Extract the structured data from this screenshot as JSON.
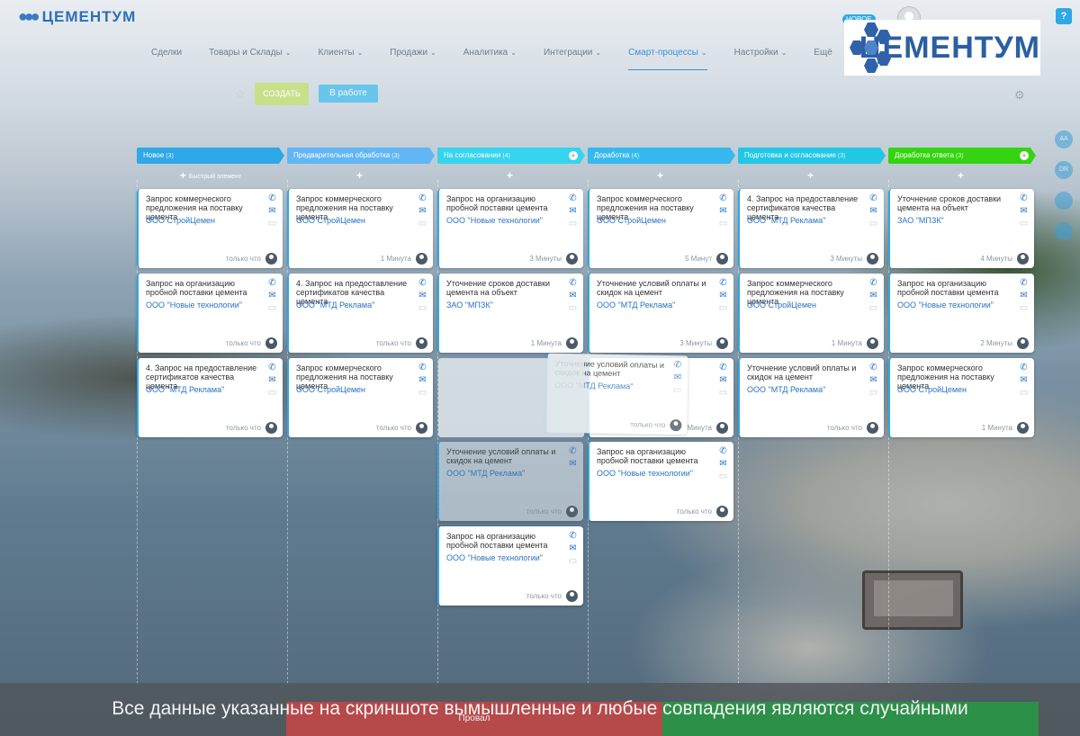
{
  "app": {
    "logo_text": "ЦЕМЕНТУМ",
    "new_badge": "НОВОЕ"
  },
  "menu": [
    {
      "label": "Сделки",
      "chevron": false,
      "active": false
    },
    {
      "label": "Товары и Склады",
      "chevron": true,
      "active": false
    },
    {
      "label": "Клиенты",
      "chevron": true,
      "active": false
    },
    {
      "label": "Продажи",
      "chevron": true,
      "active": false
    },
    {
      "label": "Аналитика",
      "chevron": true,
      "active": false
    },
    {
      "label": "Интеграции",
      "chevron": true,
      "active": false
    },
    {
      "label": "Смарт-процессы",
      "chevron": true,
      "active": true
    },
    {
      "label": "Настройки",
      "chevron": true,
      "active": false
    },
    {
      "label": "Ещё",
      "chevron": false,
      "active": false
    }
  ],
  "toolbar": {
    "create_label": "СОЗДАТЬ",
    "stage_label": "В работе"
  },
  "brand": {
    "big_logo_text": "ЦЕМЕНТУМ"
  },
  "right_rail": [
    "АА",
    "DR",
    "",
    ""
  ],
  "quick_add_label": "Быстрый элемент",
  "columns": [
    {
      "title": "Новое",
      "count": "(3)",
      "color": "#2ea8e6"
    },
    {
      "title": "Предварительная обработка",
      "count": "(3)",
      "color": "#61b6f5"
    },
    {
      "title": "На согласовании",
      "count": "(4)",
      "color": "#36d4ef"
    },
    {
      "title": "Доработка",
      "count": "(4)",
      "color": "#35b9ee"
    },
    {
      "title": "Подготовка и согласование",
      "count": "(3)",
      "color": "#22c7e6"
    },
    {
      "title": "Доработка ответа",
      "count": "(3)",
      "color": "#35d411"
    }
  ],
  "cards": [
    {
      "col": 0,
      "row": 0,
      "title": "Запрос коммерческого предложения на поставку цемента",
      "company": "ООО СтройЦемен",
      "time": "только что"
    },
    {
      "col": 0,
      "row": 1,
      "title": "Запрос на организацию пробной поставки цемента",
      "company": "ООО \"Новые технологии\"",
      "time": "только что"
    },
    {
      "col": 0,
      "row": 2,
      "title": "4. Запрос на предоставление сертификатов качества цемента",
      "company": "ООО \"МТД Реклама\"",
      "time": "только что"
    },
    {
      "col": 1,
      "row": 0,
      "title": "Запрос коммерческого предложения на поставку цемента",
      "company": "ООО СтройЦемен",
      "time": "1 Минута"
    },
    {
      "col": 1,
      "row": 1,
      "title": "4. Запрос на предоставление сертификатов качества цемента",
      "company": "ООО \"МТД Реклама\"",
      "time": "только что"
    },
    {
      "col": 1,
      "row": 2,
      "title": "Запрос коммерческого предложения на поставку цемента",
      "company": "ООО СтройЦемен",
      "time": "только что"
    },
    {
      "col": 2,
      "row": 0,
      "title": "Запрос на организацию пробной поставки цемента",
      "company": "ООО \"Новые технологии\"",
      "time": "3 Минуты"
    },
    {
      "col": 2,
      "row": 1,
      "title": "Уточнение сроков доставки цемента на объект",
      "company": "ЗАО \"МПЗК\"",
      "time": "1 Минута"
    },
    {
      "col": 2,
      "row": 3,
      "title": "Уточнение условий оплаты и скидок на цемент",
      "company": "ООО \"МТД Реклама\"",
      "time": "только что",
      "faded": true
    },
    {
      "col": 2,
      "row": 4,
      "title": "Запрос на организацию пробной поставки цемента",
      "company": "ООО \"Новые технологии\"",
      "time": "только что"
    },
    {
      "col": 3,
      "row": 0,
      "title": "Запрос коммерческого предложения на поставку цемента",
      "company": "ООО СтройЦемен",
      "time": "5 Минут"
    },
    {
      "col": 3,
      "row": 1,
      "title": "Уточнение условий оплаты и скидок на цемент",
      "company": "ООО \"МТД Реклама\"",
      "time": "3 Минуты"
    },
    {
      "col": 3,
      "row": 2,
      "title": "",
      "company": "",
      "time": "Минута"
    },
    {
      "col": 3,
      "row": 3,
      "title": "Запрос на организацию пробной поставки цемента",
      "company": "ООО \"Новые технологии\"",
      "time": "только что"
    },
    {
      "col": 4,
      "row": 0,
      "title": "4. Запрос на предоставление сертификатов качества цемента",
      "company": "ООО \"МТД Реклама\"",
      "time": "3 Минуты"
    },
    {
      "col": 4,
      "row": 1,
      "title": "Запрос коммерческого предложения на поставку цемента",
      "company": "ООО СтройЦемен",
      "time": "1 Минута"
    },
    {
      "col": 4,
      "row": 2,
      "title": "Уточнение условий оплаты и скидок на цемент",
      "company": "ООО \"МТД Реклама\"",
      "time": "только что"
    },
    {
      "col": 5,
      "row": 0,
      "title": "Уточнение сроков доставки цемента на объект",
      "company": "ЗАО \"МПЗК\"",
      "time": "4 Минуты"
    },
    {
      "col": 5,
      "row": 1,
      "title": "Запрос на организацию пробной поставки цемента",
      "company": "ООО \"Новые технологии\"",
      "time": "2 Минуты"
    },
    {
      "col": 5,
      "row": 2,
      "title": "Запрос коммерческого предложения на поставку цемента",
      "company": "ООО СтройЦемен",
      "time": "1 Минута"
    }
  ],
  "dragging": {
    "title": "Уточнение условий оплаты и скидок на цемент",
    "company": "ООО \"МТД Реклама\"",
    "time": "только что"
  },
  "bottom": {
    "disclaimer": "Все данные указанные на скриншоте вымышленные и любые совпадения являются случайными",
    "zone_fail": "Провал"
  }
}
